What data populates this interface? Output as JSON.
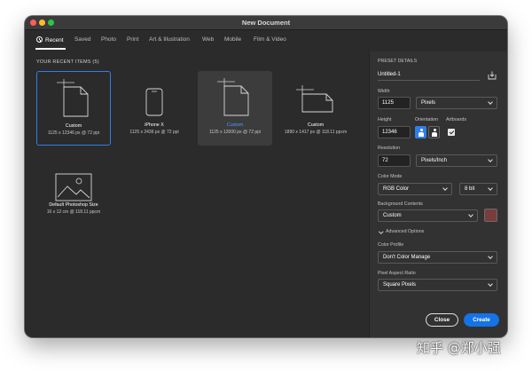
{
  "window": {
    "title": "New Document"
  },
  "tabs": [
    {
      "label": "Recent",
      "active": true
    },
    {
      "label": "Saved"
    },
    {
      "label": "Photo"
    },
    {
      "label": "Print"
    },
    {
      "label": "Art & Illustration"
    },
    {
      "label": "Web"
    },
    {
      "label": "Mobile"
    },
    {
      "label": "Film & Video"
    }
  ],
  "recent": {
    "title": "YOUR RECENT ITEMS",
    "count": "(5)",
    "items": [
      {
        "name": "Custom",
        "dims": "1125 x 12346 px @ 72 ppi",
        "icon": "document-icon",
        "state": "selected"
      },
      {
        "name": "iPhone X",
        "dims": "1125 x 2436 px @ 72 ppi",
        "icon": "phone-icon"
      },
      {
        "name": "Custom",
        "dims": "1125 x 12000 px @ 72 ppi",
        "icon": "document-icon",
        "state": "hover"
      },
      {
        "name": "Custom",
        "dims": "1890 x 1417 px @ 118.11 ppcm",
        "icon": "document-landscape-icon"
      },
      {
        "name": "Default Photoshop Size",
        "dims": "16 x 12 cm @ 118.11 ppcm",
        "icon": "image-icon"
      }
    ]
  },
  "preset_details": {
    "title": "PRESET DETAILS",
    "name": "Untitled-1",
    "width_label": "Width",
    "width_value": "1125",
    "width_unit": "Pixels",
    "height_label": "Height",
    "height_value": "12346",
    "orientation_label": "Orientation",
    "artboards_label": "Artboards",
    "artboards_checked": true,
    "resolution_label": "Resolution",
    "resolution_value": "72",
    "resolution_unit": "Pixels/Inch",
    "color_mode_label": "Color Mode",
    "color_mode_value": "RGB Color",
    "bit_depth_value": "8 bit",
    "background_label": "Background Contents",
    "background_value": "Custom",
    "background_color": "#7a3d3d",
    "advanced_label": "Advanced Options",
    "color_profile_label": "Color Profile",
    "color_profile_value": "Don't Color Manage",
    "pixel_aspect_label": "Pixel Aspect Ratio",
    "pixel_aspect_value": "Square Pixels"
  },
  "buttons": {
    "close": "Close",
    "create": "Create"
  },
  "colors": {
    "accent": "#1473e6",
    "selection": "#2e7fe6",
    "panel": "#2b2b2b",
    "right_panel": "#323232"
  },
  "watermark": "知乎 @郑小强"
}
